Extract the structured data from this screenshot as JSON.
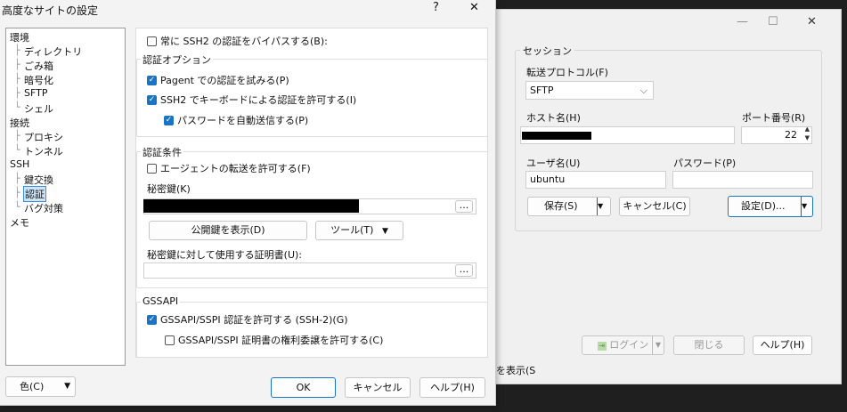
{
  "dialog": {
    "title": "高度なサイトの設定",
    "help_glyph": "?",
    "close_glyph": "✕",
    "tree": [
      {
        "label": "環境"
      },
      {
        "label": "ディレクトリ"
      },
      {
        "label": "ごみ箱"
      },
      {
        "label": "暗号化"
      },
      {
        "label": "SFTP"
      },
      {
        "label": "シェル"
      },
      {
        "label": "接続"
      },
      {
        "label": "プロキシ"
      },
      {
        "label": "トンネル"
      },
      {
        "label": "SSH"
      },
      {
        "label": "鍵交換"
      },
      {
        "label": "認証",
        "selected": true
      },
      {
        "label": "バグ対策"
      },
      {
        "label": "メモ"
      }
    ],
    "bypass_label": "常に SSH2 の認証をバイパスする(B):",
    "bypass_checked": false,
    "auth_options": {
      "legend": "認証オプション",
      "pageant_label": "Pagent での認証を試みる(P)",
      "pageant_checked": true,
      "keyboard_label": "SSH2 でキーボードによる認証を許可する(I)",
      "keyboard_checked": true,
      "autosend_label": "パスワードを自動送信する(P)",
      "autosend_checked": true
    },
    "auth_params": {
      "legend": "認証条件",
      "agent_label": "エージェントの転送を許可する(F)",
      "agent_checked": false,
      "privkey_label": "秘密鍵(K)",
      "browse_label": "...",
      "show_pubkey_label": "公開鍵を表示(D)",
      "tools_label": "ツール(T)",
      "cert_label": "秘密鍵に対して使用する証明書(U):"
    },
    "gssapi": {
      "legend": "GSSAPI",
      "allow_label": "GSSAPI/SSPI 認証を許可する (SSH-2)(G)",
      "allow_checked": true,
      "delegate_label": "GSSAPI/SSPI 証明書の権利委譲を許可する(C)",
      "delegate_checked": false
    },
    "color_button_label": "色(C)",
    "ok_label": "OK",
    "cancel_label": "キャンセル",
    "help_label": "ヘルプ(H)"
  },
  "login": {
    "session_legend": "セッション",
    "protocol_label": "転送プロトコル(F)",
    "protocol_value": "SFTP",
    "host_label": "ホスト名(H)",
    "port_label": "ポート番号(R)",
    "port_value": "22",
    "user_label": "ユーザ名(U)",
    "user_value": "ubuntu",
    "password_label": "パスワード(P)",
    "save_label": "保存(S)",
    "cancel_label": "キャンセル(C)",
    "settings_label": "設定(D)...",
    "login_label": "ログイン",
    "close_label": "閉じる",
    "help_label": "ヘルプ(H)",
    "show_label": "を表示(S"
  },
  "colors": {
    "accent": "#1a73c4",
    "selection": "#cce4f7"
  }
}
